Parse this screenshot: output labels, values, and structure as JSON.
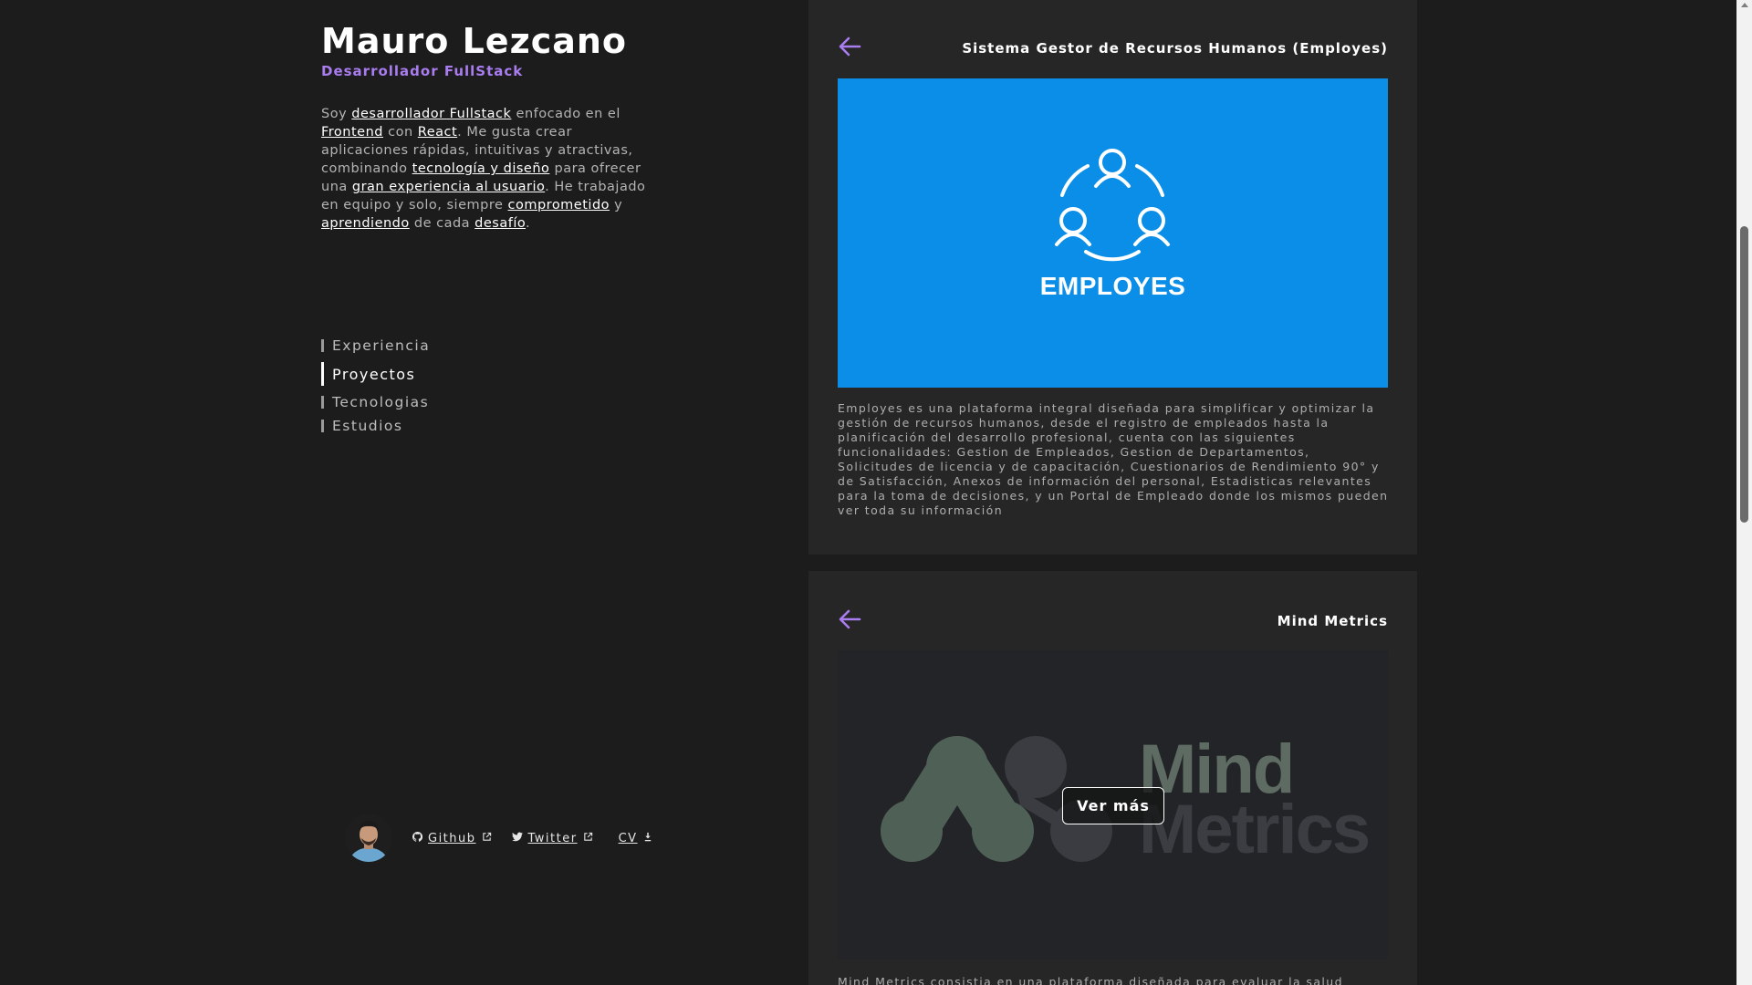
{
  "profile": {
    "name": "Mauro Lezcano",
    "role": "Desarrollador FullStack",
    "bio": [
      {
        "t": "Soy ",
        "h": false
      },
      {
        "t": "desarrollador Fullstack",
        "h": true
      },
      {
        "t": " enfocado en el ",
        "h": false
      },
      {
        "t": "Frontend",
        "h": true
      },
      {
        "t": " con ",
        "h": false
      },
      {
        "t": "React",
        "h": true
      },
      {
        "t": ". Me gusta crear aplicaciones rápidas, intuitivas y atractivas, combinando ",
        "h": false
      },
      {
        "t": "tecnología y diseño",
        "h": true
      },
      {
        "t": " para ofrecer una ",
        "h": false
      },
      {
        "t": "gran experiencia al usuario",
        "h": true
      },
      {
        "t": ". He trabajado en equipo y solo, siempre ",
        "h": false
      },
      {
        "t": "comprometido",
        "h": true
      },
      {
        "t": " y ",
        "h": false
      },
      {
        "t": "aprendiendo",
        "h": true
      },
      {
        "t": " de cada ",
        "h": false
      },
      {
        "t": "desafío",
        "h": true
      },
      {
        "t": ".",
        "h": false
      }
    ]
  },
  "nav": {
    "items": [
      "Experiencia",
      "Proyectos",
      "Tecnologias",
      "Estudios"
    ],
    "active": "Proyectos"
  },
  "social": {
    "github": "Github",
    "twitter": "Twitter",
    "cv": "CV"
  },
  "projects": [
    {
      "title": "Sistema Gestor de Recursos Humanos (Employes)",
      "image_text": "EMPLOYES",
      "description": "Employes es una plataforma integral diseñada para simplificar y optimizar la gestión de recursos humanos, desde el registro de empleados hasta la planificación del desarrollo profesional, cuenta con las siguientes funcionalidades: Gestion de Empleados, Gestion de Departamentos, Solicitudes de licencia y de capacitación, Cuestionarios de Rendimiento 90° y de Satisfacción, Anexos de información del personal, Estadisticas relevantes para la toma de decisiones, y un Portal de Empleado donde los mismos pueden ver toda su información"
    },
    {
      "title": "Mind Metrics",
      "image_text_line1": "Mind",
      "image_text_line2": "Metrics",
      "button": "Ver más",
      "description": "Mind Metrics consistia en una plataforma diseñada para evaluar la salud mental"
    }
  ],
  "colors": {
    "background": "#1c1c1c",
    "card": "#262626",
    "accent": "#a97cf0",
    "employes_blue": "#0a8ee8"
  }
}
